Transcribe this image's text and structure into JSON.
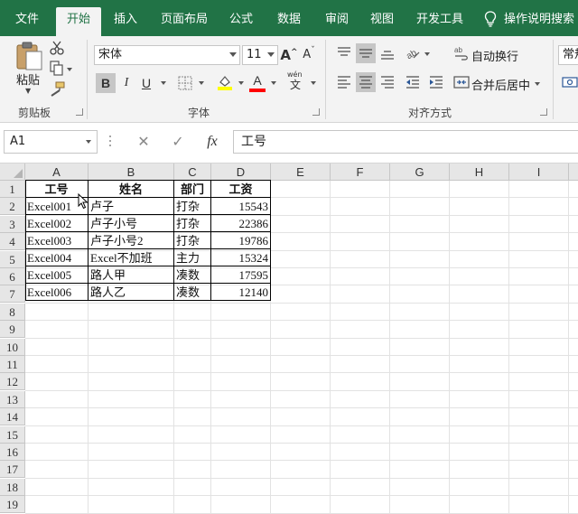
{
  "tabs": [
    {
      "label": "文件",
      "active": false
    },
    {
      "label": "开始",
      "active": true
    },
    {
      "label": "插入",
      "active": false
    },
    {
      "label": "页面布局",
      "active": false
    },
    {
      "label": "公式",
      "active": false
    },
    {
      "label": "数据",
      "active": false
    },
    {
      "label": "审阅",
      "active": false
    },
    {
      "label": "视图",
      "active": false
    },
    {
      "label": "开发工具",
      "active": false
    }
  ],
  "tell_me": "操作说明搜索",
  "ribbon": {
    "clipboard": {
      "paste_label": "粘贴",
      "group_label": "剪贴板"
    },
    "font": {
      "font_name": "宋体",
      "font_size": "11",
      "grow_label": "A",
      "shrink_label": "A",
      "bold_label": "B",
      "italic_label": "I",
      "underline_label": "U",
      "font_color_label": "A",
      "phonetic_label": "文",
      "phonetic_top": "wén",
      "group_label": "字体"
    },
    "alignment": {
      "wrap_label": "自动换行",
      "merge_label": "合并后居中",
      "group_label": "对齐方式"
    },
    "number": {
      "format_value": "常规"
    }
  },
  "formula_bar": {
    "name_box": "A1",
    "cancel": "✕",
    "enter": "✓",
    "fx": "fx",
    "content": "工号"
  },
  "sheet": {
    "columns": [
      "A",
      "B",
      "C",
      "D",
      "E",
      "F",
      "G",
      "H",
      "I"
    ],
    "rows": [
      "1",
      "2",
      "3",
      "4",
      "5",
      "6",
      "7",
      "8",
      "9",
      "10",
      "11",
      "12",
      "13",
      "14",
      "15",
      "16",
      "17",
      "18",
      "19"
    ],
    "header": [
      "工号",
      "姓名",
      "部门",
      "工资"
    ],
    "data": [
      [
        "Excel001",
        "卢子",
        "打杂",
        "15543"
      ],
      [
        "Excel002",
        "卢子小号",
        "打杂",
        "22386"
      ],
      [
        "Excel003",
        "卢子小号2",
        "打杂",
        "19786"
      ],
      [
        "Excel004",
        "Excel不加班",
        "主力",
        "15324"
      ],
      [
        "Excel005",
        "路人甲",
        "凑数",
        "17595"
      ],
      [
        "Excel006",
        "路人乙",
        "凑数",
        "12140"
      ]
    ]
  },
  "colors": {
    "accent": "#217346",
    "fill_highlight": "#ffff00",
    "font_color": "#ff0000"
  }
}
